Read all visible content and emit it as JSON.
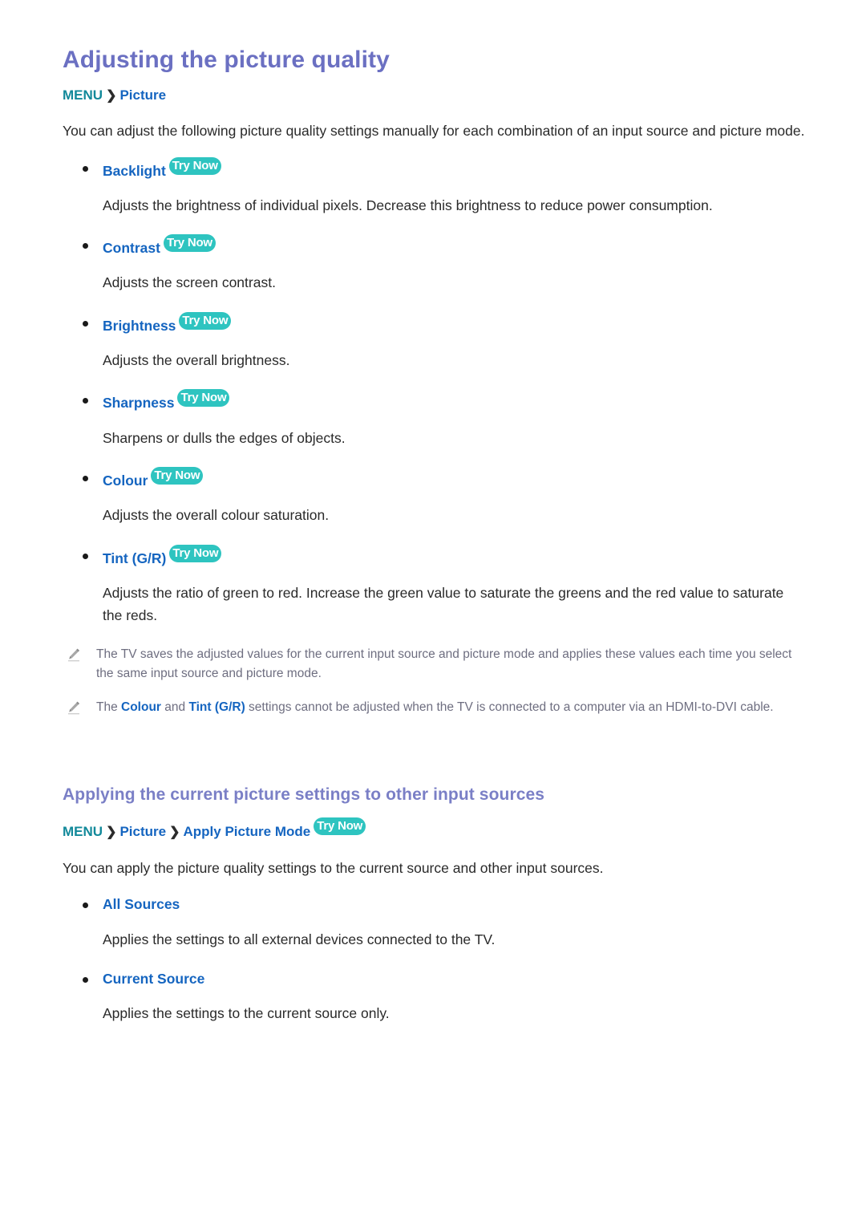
{
  "colors": {
    "title": "#6b70c2",
    "section_title": "#7a7fc6",
    "menu_teal": "#12899a",
    "link_blue": "#1565c0",
    "badge_teal": "#2ec4c0",
    "body_text": "#2a2a2a",
    "note_text": "#6e6e80"
  },
  "badge": {
    "try_now": "Try Now"
  },
  "section1": {
    "title": "Adjusting the picture quality",
    "breadcrumb": {
      "menu": "MENU",
      "separator": "❯",
      "item1": "Picture"
    },
    "intro": "You can adjust the following picture quality settings manually for each combination of an input source and picture mode.",
    "bullets": [
      {
        "label": "Backlight",
        "has_try_now": true,
        "desc": "Adjusts the brightness of individual pixels. Decrease this brightness to reduce power consumption."
      },
      {
        "label": "Contrast",
        "has_try_now": true,
        "desc": "Adjusts the screen contrast."
      },
      {
        "label": "Brightness",
        "has_try_now": true,
        "desc": "Adjusts the overall brightness."
      },
      {
        "label": "Sharpness",
        "has_try_now": true,
        "desc": "Sharpens or dulls the edges of objects."
      },
      {
        "label": "Colour",
        "has_try_now": true,
        "desc": "Adjusts the overall colour saturation."
      },
      {
        "label": "Tint (G/R)",
        "has_try_now": true,
        "desc": "Adjusts the ratio of green to red. Increase the green value to saturate the greens and the red value to saturate the reds."
      }
    ],
    "notes": [
      {
        "icon": "pencil-icon",
        "text_plain": "The TV saves the adjusted values for the current input source and picture mode and applies these values each time you select the same input source and picture mode."
      },
      {
        "icon": "pencil-icon",
        "text_parts": {
          "before": "The ",
          "bold1": "Colour",
          "middle": " and ",
          "bold2": "Tint (G/R)",
          "after": " settings cannot be adjusted when the TV is connected to a computer via an HDMI-to-DVI cable."
        }
      }
    ]
  },
  "section2": {
    "title": "Applying the current picture settings to other input sources",
    "breadcrumb": {
      "menu": "MENU",
      "separator": "❯",
      "item1": "Picture",
      "item2": "Apply Picture Mode"
    },
    "intro": "You can apply the picture quality settings to the current source and other input sources.",
    "bullets": [
      {
        "label": "All Sources",
        "has_try_now": false,
        "desc": "Applies the settings to all external devices connected to the TV."
      },
      {
        "label": "Current Source",
        "has_try_now": false,
        "desc": "Applies the settings to the current source only."
      }
    ]
  }
}
